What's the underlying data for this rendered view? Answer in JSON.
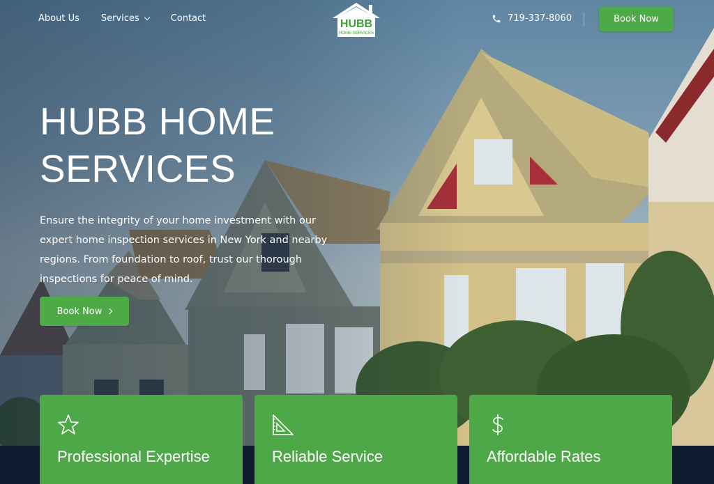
{
  "nav": {
    "about": "About Us",
    "services": "Services",
    "contact": "Contact"
  },
  "logo": {
    "name": "HUBB",
    "tagline": "HOME SERVICES"
  },
  "header": {
    "phone": "719-337-8060",
    "book_now": "Book Now"
  },
  "hero": {
    "title_line1": "HUBB HOME",
    "title_line2": "SERVICES",
    "description": "Ensure the integrity of your home investment with our expert home inspection services in New York and nearby regions. From foundation to roof, trust our thorough inspections for peace of mind.",
    "cta": "Book Now"
  },
  "features": [
    {
      "label": "Professional Expertise",
      "icon": "star-icon"
    },
    {
      "label": "Reliable Service",
      "icon": "set-square-icon"
    },
    {
      "label": "Affordable Rates",
      "icon": "dollar-icon"
    }
  ],
  "colors": {
    "accent_green": "#4daa47",
    "footer_navy": "#0f1b2e"
  }
}
